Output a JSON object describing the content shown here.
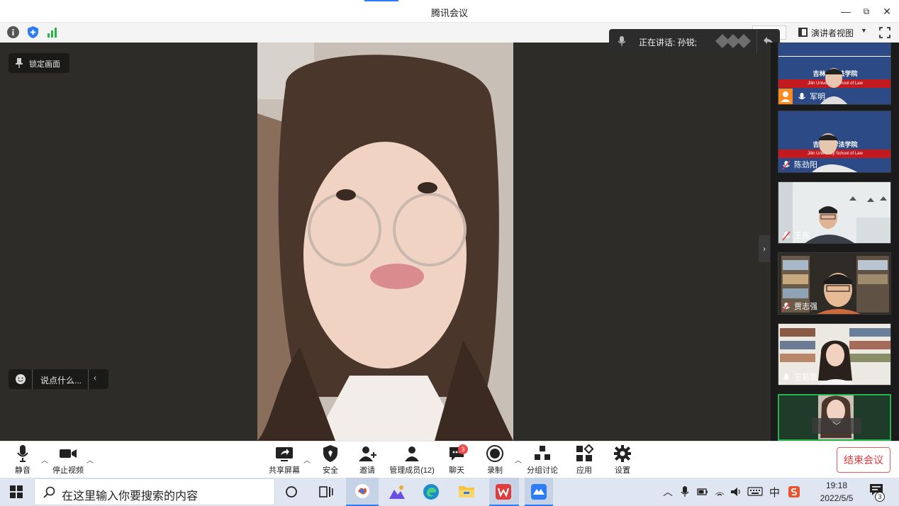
{
  "window": {
    "title": "腾讯会议",
    "minimize": "—",
    "restore": "⧉",
    "close": "✕"
  },
  "infobar": {
    "view_mode": "演讲者视图"
  },
  "speaking": {
    "label": "正在讲话: 孙锐;"
  },
  "overlays": {
    "lock_screen": "锁定画面",
    "say_something": "说点什么..."
  },
  "participants": [
    {
      "name": "军明",
      "banner_cn": "吉林大学法学院",
      "banner_en": "Jilin University School of Law"
    },
    {
      "name": "陈劲阳",
      "banner_cn": "吉林大学法学院",
      "banner_en": "Jilin University School of Law"
    },
    {
      "name": "王充"
    },
    {
      "name": "贾志强"
    },
    {
      "name": "王若思"
    },
    {
      "name": ""
    }
  ],
  "toolbar": {
    "mute": "静音",
    "stop_video": "停止视频",
    "share_screen": "共享屏幕",
    "security": "安全",
    "invite": "邀请",
    "manage_members": "管理成员(12)",
    "chat": "聊天",
    "chat_badge": "3",
    "record": "录制",
    "breakout": "分组讨论",
    "apps": "应用",
    "settings": "设置",
    "end_meeting": "结束会议"
  },
  "taskbar": {
    "search_placeholder": "在这里输入你要搜索的内容",
    "ime": "中",
    "time": "19:18",
    "date": "2022/5/5",
    "notifications": "3"
  },
  "colors": {
    "brand_blue": "#2d7cf6",
    "end_red": "#e03a3a",
    "badge_red": "#f04a4a"
  }
}
